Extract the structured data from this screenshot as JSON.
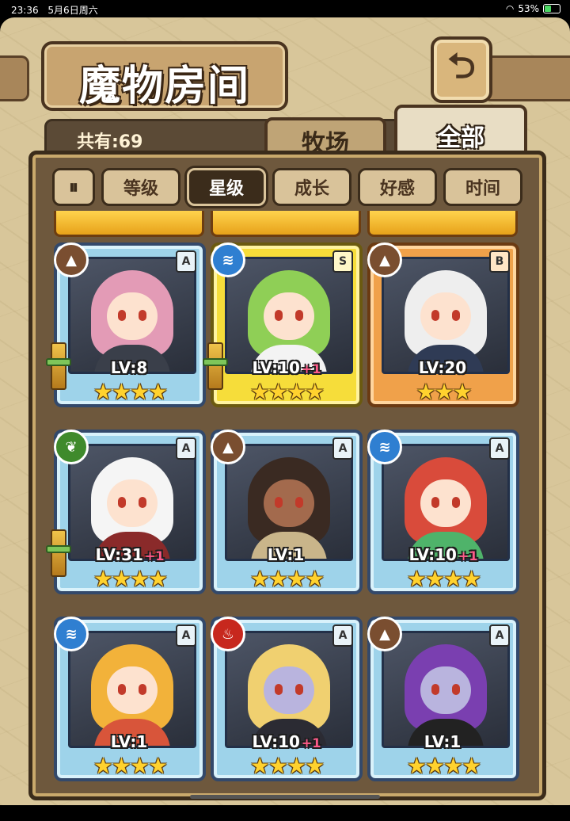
{
  "status": {
    "time": "23:36",
    "date": "5月6日周六",
    "battery": "53%",
    "battery_level": 0.53
  },
  "header": {
    "title": "魔物房间",
    "back_icon": "back-arrow-icon"
  },
  "owned": {
    "label": "共有:69"
  },
  "tabs": [
    {
      "label": "牧场"
    },
    {
      "label": "全部",
      "active": true
    }
  ],
  "sort": {
    "pause_icon": "⏸",
    "buttons": [
      {
        "label": "等级",
        "active": false
      },
      {
        "label": "星级",
        "active": true
      },
      {
        "label": "成长",
        "active": false
      },
      {
        "label": "好感",
        "active": false
      },
      {
        "label": "时间",
        "active": false
      }
    ]
  },
  "cards": [
    {
      "element": "earth",
      "element_icon": "earth-icon",
      "rank": "A",
      "level": "LV:8",
      "plus": "",
      "stars": 4,
      "frame": "blue",
      "weapon": true,
      "hair": "#e39bb6",
      "skin": "light",
      "outfit": "#3a3f4a"
    },
    {
      "element": "water",
      "element_icon": "water-icon",
      "rank": "S",
      "level": "LV:10",
      "plus": "+1",
      "stars": 4,
      "frame": "gold",
      "weapon": true,
      "hair": "#8fcf56",
      "skin": "light",
      "outfit": "#f3f3f3"
    },
    {
      "element": "earth",
      "element_icon": "earth-icon",
      "rank": "B",
      "level": "LV:20",
      "plus": "",
      "stars": 3,
      "frame": "bronze",
      "weapon": false,
      "hair": "#eeeeee",
      "skin": "light",
      "outfit": "#2f3b55"
    },
    {
      "element": "grass",
      "element_icon": "leaf-icon",
      "rank": "A",
      "level": "LV:31",
      "plus": "+1",
      "stars": 4,
      "frame": "blue",
      "weapon": true,
      "hair": "#f5f5f5",
      "skin": "light",
      "outfit": "#8a2a2a"
    },
    {
      "element": "earth",
      "element_icon": "earth-icon",
      "rank": "A",
      "level": "LV:1",
      "plus": "",
      "stars": 4,
      "frame": "blue",
      "weapon": false,
      "hair": "#3a2a22",
      "skin": "dark",
      "outfit": "#c9b58a"
    },
    {
      "element": "water",
      "element_icon": "water-icon",
      "rank": "A",
      "level": "LV:10",
      "plus": "+1",
      "stars": 4,
      "frame": "blue",
      "weapon": false,
      "hair": "#d94b3b",
      "skin": "light",
      "outfit": "#4fb36a"
    },
    {
      "element": "water",
      "element_icon": "water-icon",
      "rank": "A",
      "level": "LV:1",
      "plus": "",
      "stars": 4,
      "frame": "blue",
      "weapon": false,
      "hair": "#f2b23a",
      "skin": "light",
      "outfit": "#d8553a"
    },
    {
      "element": "fire",
      "element_icon": "fire-icon",
      "rank": "A",
      "level": "LV:10",
      "plus": "+1",
      "stars": 4,
      "frame": "blue",
      "weapon": false,
      "hair": "#f0d070",
      "skin": "purple",
      "outfit": "#2b2b33"
    },
    {
      "element": "earth",
      "element_icon": "earth-icon",
      "rank": "A",
      "level": "LV:1",
      "plus": "",
      "stars": 4,
      "frame": "blue",
      "weapon": false,
      "hair": "#7a3fb0",
      "skin": "purple",
      "outfit": "#222222"
    }
  ]
}
